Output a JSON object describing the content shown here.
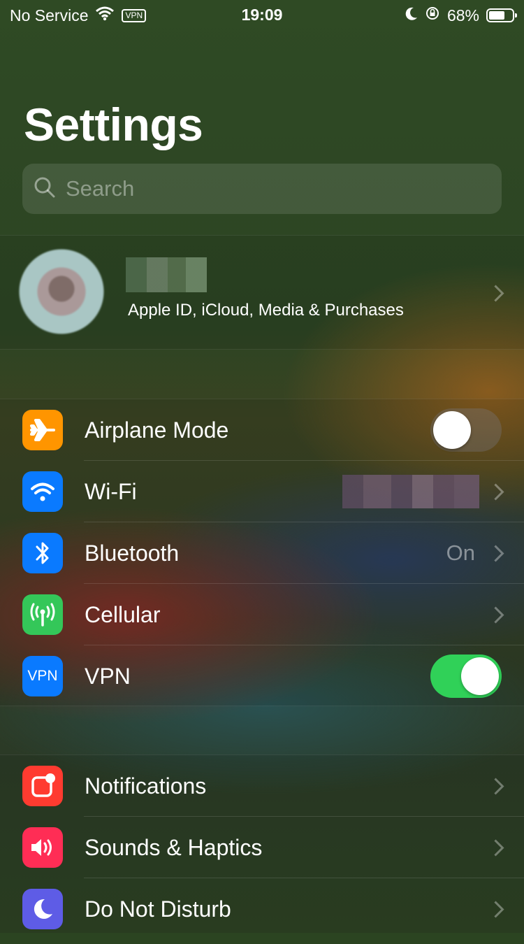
{
  "status_bar": {
    "carrier": "No Service",
    "vpn_badge": "VPN",
    "time": "19:09",
    "battery": "68%",
    "battery_level": 0.68
  },
  "title": "Settings",
  "search": {
    "placeholder": "Search"
  },
  "profile": {
    "subtitle": "Apple ID, iCloud, Media & Purchases"
  },
  "connectivity": [
    {
      "label": "Airplane Mode",
      "icon": "airplane-icon",
      "color": "#ff9500",
      "toggle": false
    },
    {
      "label": "Wi-Fi",
      "icon": "wifi-icon",
      "color": "#0a7aff",
      "value": ""
    },
    {
      "label": "Bluetooth",
      "icon": "bluetooth-icon",
      "color": "#0a7aff",
      "value": "On"
    },
    {
      "label": "Cellular",
      "icon": "cellular-icon",
      "color": "#34c759"
    },
    {
      "label": "VPN",
      "icon": "vpn-icon",
      "icon_text": "VPN",
      "color": "#0a7aff",
      "toggle": true
    }
  ],
  "general": [
    {
      "label": "Notifications",
      "icon": "notifications-icon",
      "color": "#ff3b30"
    },
    {
      "label": "Sounds & Haptics",
      "icon": "speaker-icon",
      "color": "#ff2d55"
    },
    {
      "label": "Do Not Disturb",
      "icon": "moon-icon",
      "color": "#5e5ce6"
    }
  ]
}
